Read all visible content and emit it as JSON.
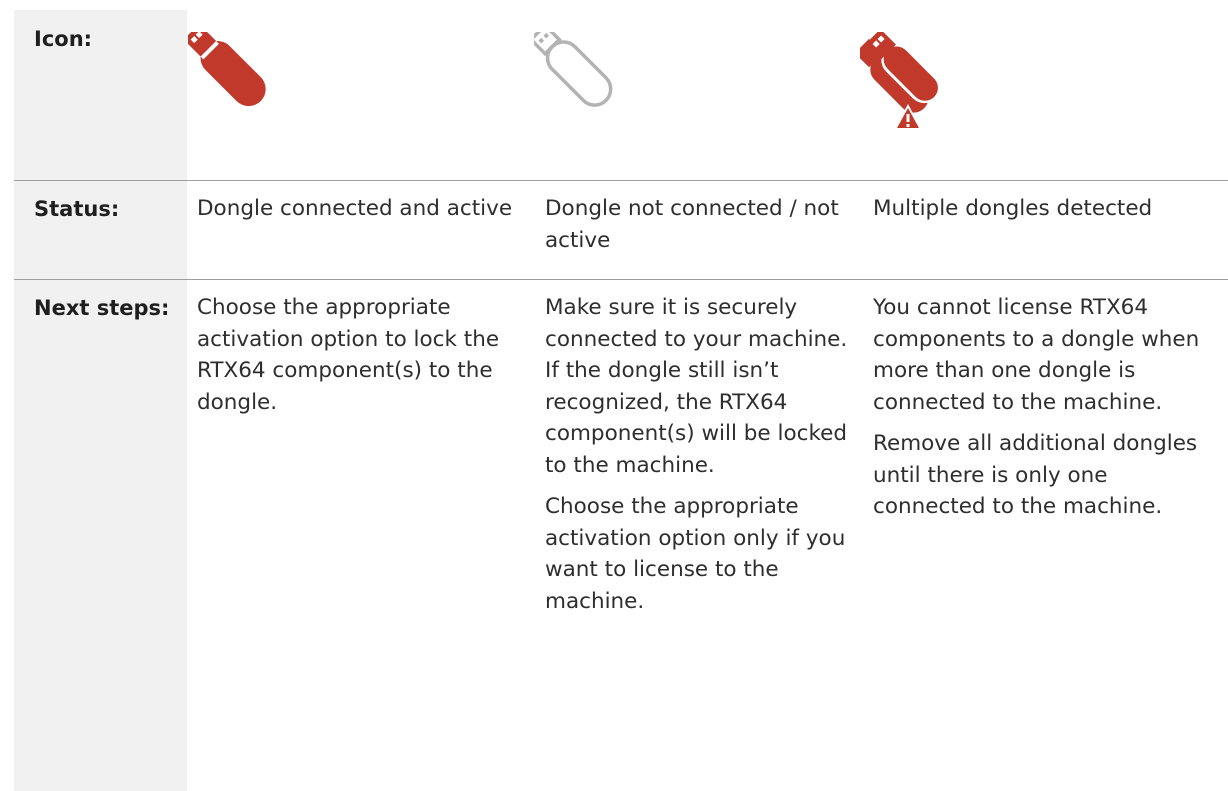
{
  "table": {
    "rows": {
      "icon": {
        "label": "Icon:"
      },
      "status": {
        "label": "Status:",
        "cells": [
          "Dongle connected and active",
          "Dongle not connected / not active",
          "Multiple dongles detected"
        ]
      },
      "next_steps": {
        "label": "Next steps:",
        "cells": [
          {
            "paragraphs": [
              "Choose the appropriate activation option to lock the RTX64 component(s) to the dongle."
            ]
          },
          {
            "paragraphs": [
              "Make sure it is securely connected to your machine. If the dongle still isn’t recognized, the RTX64 component(s) will be locked to the machine.",
              "Choose the appropriate activation option only if you want to license to the machine."
            ]
          },
          {
            "paragraphs": [
              "You cannot license RTX64 components to a dongle when more than one dongle is connected to the machine.",
              "Remove all additional dongles until there is only one connected to the machine."
            ]
          }
        ]
      }
    }
  },
  "icons": [
    {
      "name": "usb-dongle-active-icon",
      "color": "#c0392b"
    },
    {
      "name": "usb-dongle-inactive-icon",
      "color": "#b3b3b3"
    },
    {
      "name": "usb-dongles-multiple-warning-icon",
      "color": "#c0392b"
    }
  ]
}
